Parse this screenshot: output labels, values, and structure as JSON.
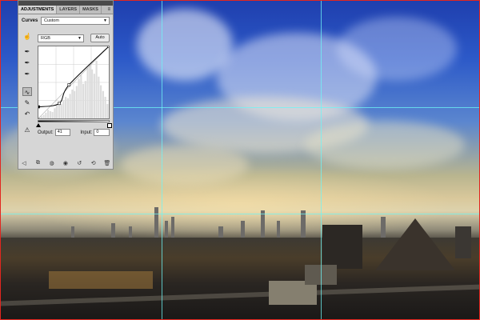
{
  "panel": {
    "tabs": [
      "ADJUSTMENTS",
      "LAYERS",
      "MASKS"
    ],
    "menu_icon": "panel-menu-icon",
    "adjustment_label": "Curves",
    "preset_value": "Custom",
    "channel_value": "RGB",
    "auto_label": "Auto",
    "output_label": "Output:",
    "output_value": "41",
    "input_label": "Input:",
    "input_value": "0",
    "tools": [
      "hand-adjust-icon",
      "black-eyedropper-icon",
      "gray-eyedropper-icon",
      "white-eyedropper-icon",
      "curve-edit-icon",
      "pencil-icon",
      "smooth-icon",
      "warning-icon"
    ],
    "bottom_icons": [
      "back-arrow-icon",
      "clip-layer-icon",
      "visibility-icon",
      "eye-preview-icon",
      "previous-state-icon",
      "reset-icon",
      "delete-icon"
    ]
  },
  "curve": {
    "input_range": [
      0,
      255
    ],
    "output_range": [
      0,
      255
    ],
    "points": [
      [
        0,
        41
      ],
      [
        75,
        53
      ],
      [
        111,
        119
      ],
      [
        255,
        255
      ]
    ]
  },
  "colors": {
    "guide": "#6ef5f5",
    "canvas_border": "#e3261f"
  }
}
